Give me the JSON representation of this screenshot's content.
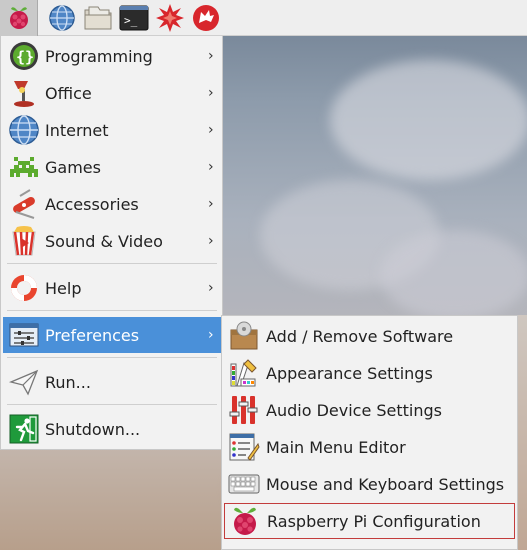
{
  "taskbar": {
    "icons": [
      "raspberry-menu-icon",
      "web-browser-icon",
      "file-manager-icon",
      "terminal-icon",
      "mathematica-icon",
      "wolfram-icon"
    ],
    "terminal_glyph": ">_"
  },
  "main_menu": {
    "items": [
      {
        "label": "Programming",
        "icon": "programming-icon",
        "submenu": true
      },
      {
        "label": "Office",
        "icon": "office-icon",
        "submenu": true
      },
      {
        "label": "Internet",
        "icon": "internet-icon",
        "submenu": true
      },
      {
        "label": "Games",
        "icon": "games-icon",
        "submenu": true
      },
      {
        "label": "Accessories",
        "icon": "accessories-icon",
        "submenu": true
      },
      {
        "label": "Sound & Video",
        "icon": "sound-video-icon",
        "submenu": true
      },
      {
        "label": "Help",
        "icon": "help-icon",
        "submenu": true
      },
      {
        "label": "Preferences",
        "icon": "preferences-icon",
        "submenu": true,
        "selected": true
      },
      {
        "label": "Run...",
        "icon": "run-icon",
        "submenu": false
      },
      {
        "label": "Shutdown...",
        "icon": "shutdown-icon",
        "submenu": false
      }
    ],
    "arrow_glyph": "›",
    "programming_glyph": "{}"
  },
  "preferences_submenu": {
    "items": [
      {
        "label": "Add / Remove Software",
        "icon": "package-icon"
      },
      {
        "label": "Appearance Settings",
        "icon": "palette-icon"
      },
      {
        "label": "Audio Device Settings",
        "icon": "mixer-icon"
      },
      {
        "label": "Main Menu Editor",
        "icon": "menu-editor-icon"
      },
      {
        "label": "Mouse and Keyboard Settings",
        "icon": "keyboard-icon"
      },
      {
        "label": "Raspberry Pi Configuration",
        "icon": "raspberry-icon",
        "focused": true
      }
    ]
  },
  "colors": {
    "selection": "#4a90d9",
    "focus_border": "#c33c3c",
    "menu_bg": "#f2f2f2",
    "taskbar_bg": "#eeeeee"
  }
}
